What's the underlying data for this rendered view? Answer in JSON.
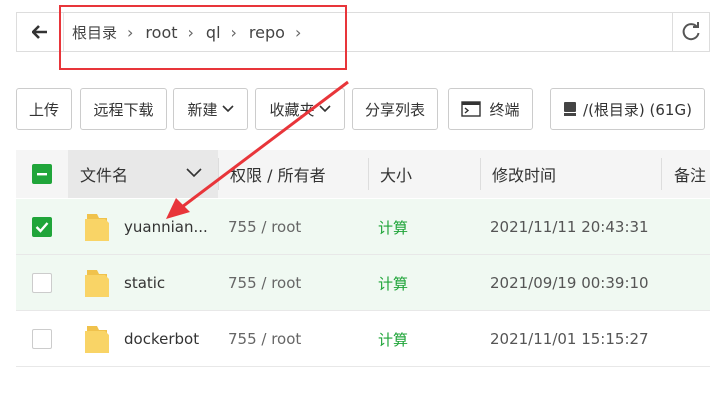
{
  "breadcrumb": {
    "back_icon": "back-arrow-icon",
    "items": [
      "根目录",
      "root",
      "ql",
      "repo"
    ],
    "refresh_icon": "refresh-icon"
  },
  "toolbar": {
    "upload": "上传",
    "remote_download": "远程下载",
    "new": "新建",
    "favorites": "收藏夹",
    "share_list": "分享列表",
    "terminal": "终端",
    "disk": "/(根目录) (61G)"
  },
  "table": {
    "headers": {
      "name": "文件名",
      "permission": "权限 / 所有者",
      "size": "大小",
      "mtime": "修改时间",
      "note": "备注"
    },
    "rows": [
      {
        "checked": true,
        "name": "yuannian...",
        "perm": "755 / root",
        "size": "计算",
        "mtime": "2021/11/11 20:43:31"
      },
      {
        "checked": false,
        "name": "static",
        "perm": "755 / root",
        "size": "计算",
        "mtime": "2021/09/19 00:39:10"
      },
      {
        "checked": false,
        "name": "dockerbot",
        "perm": "755 / root",
        "size": "计算",
        "mtime": "2021/11/01 15:15:27"
      }
    ]
  },
  "colors": {
    "accent": "#20a53a",
    "highlight": "#e8353a",
    "selected_row": "#f0f9f2",
    "folder": "#f9d466"
  }
}
